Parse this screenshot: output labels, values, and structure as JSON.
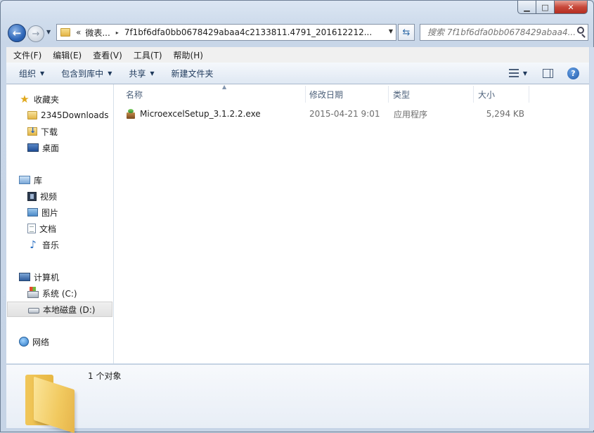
{
  "window": {
    "caption": {
      "minimize": "▁",
      "maximize": "□",
      "close": "✕"
    }
  },
  "nav": {
    "back_icon": "arrow-left-icon",
    "forward_icon": "arrow-right-icon",
    "address": {
      "overflow": "«",
      "segment": "微表...",
      "separator": "▸",
      "path": "7f1bf6dfa0bb0678429abaa4c2133811.4791_201612212...",
      "dropdown": "▼"
    },
    "refresh": "⇆",
    "search_placeholder": "搜索 7f1bf6dfa0bb0678429abaa4..."
  },
  "menubar": {
    "items": [
      "文件(F)",
      "编辑(E)",
      "查看(V)",
      "工具(T)",
      "帮助(H)"
    ]
  },
  "commandbar": {
    "organize": "组织",
    "include_in_library": "包含到库中",
    "share": "共享",
    "new_folder": "新建文件夹"
  },
  "navpane": {
    "favorites": "收藏夹",
    "downloads_2345": "2345Downloads",
    "downloads": "下载",
    "desktop": "桌面",
    "libraries": "库",
    "videos": "视频",
    "pictures": "图片",
    "documents": "文档",
    "music": "音乐",
    "computer": "计算机",
    "drive_c": "系统 (C:)",
    "drive_d": "本地磁盘 (D:)",
    "network": "网络"
  },
  "filelist": {
    "columns": {
      "name": "名称",
      "date": "修改日期",
      "type": "类型",
      "size": "大小"
    },
    "rows": [
      {
        "name": "MicroexcelSetup_3.1.2.2.exe",
        "date": "2015-04-21 9:01",
        "type": "应用程序",
        "size": "5,294 KB"
      }
    ]
  },
  "details": {
    "count": "1 个对象"
  }
}
